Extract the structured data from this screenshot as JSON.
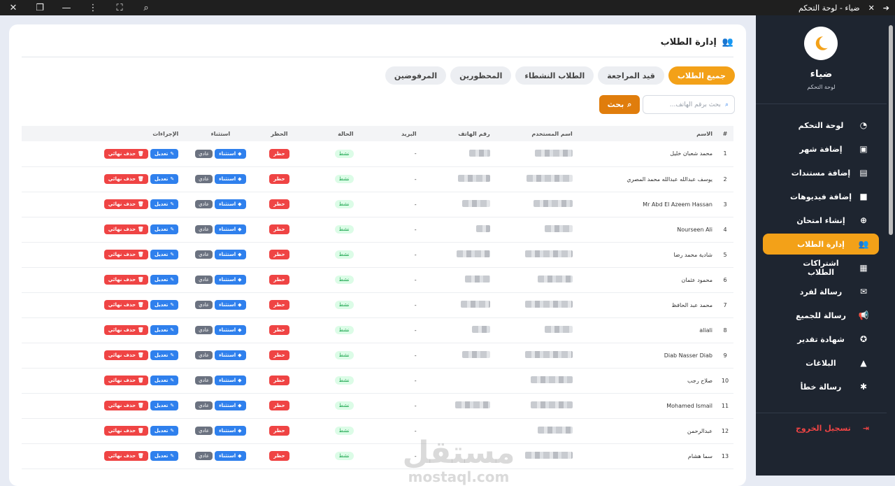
{
  "window": {
    "title": "ضياء - لوحة التحكم"
  },
  "sidebar": {
    "brand": "ضياء",
    "brand_sub": "لوحة التحكم",
    "items": [
      {
        "label": "لوحة التحكم",
        "icon": "dashboard-icon",
        "active": false
      },
      {
        "label": "إضافة شهر",
        "icon": "calendar-plus-icon",
        "active": false
      },
      {
        "label": "إضافة مستندات",
        "icon": "file-icon",
        "active": false
      },
      {
        "label": "إضافة فيديوهات",
        "icon": "video-icon",
        "active": false
      },
      {
        "label": "إنشاء امتحان",
        "icon": "plus-circle-icon",
        "active": false
      },
      {
        "label": "إدارة الطلاب",
        "icon": "users-icon",
        "active": true
      },
      {
        "label": "اشتراكات الطلاب",
        "icon": "calendar-check-icon",
        "active": false
      },
      {
        "label": "رسالة لفرد",
        "icon": "envelope-icon",
        "active": false
      },
      {
        "label": "رسالة للجميع",
        "icon": "megaphone-icon",
        "active": false
      },
      {
        "label": "شهادة تقدير",
        "icon": "award-icon",
        "active": false
      },
      {
        "label": "البلاغات",
        "icon": "warning-icon",
        "active": false
      },
      {
        "label": "رسالة خطأ",
        "icon": "bug-icon",
        "active": false
      }
    ],
    "logout": "تسجيل الخروج"
  },
  "main": {
    "title": "إدارة الطلاب",
    "tabs": [
      {
        "label": "جميع الطلاب",
        "active": true
      },
      {
        "label": "قيد المراجعة",
        "active": false
      },
      {
        "label": "الطلاب النشطاء",
        "active": false
      },
      {
        "label": "المحظورين",
        "active": false
      },
      {
        "label": "المرفوضين",
        "active": false
      }
    ],
    "search_placeholder": "بحث برقم الهاتف...",
    "search_button": "بحث",
    "columns": {
      "num": "#",
      "name": "الاسم",
      "user": "اسم المستخدم",
      "phone": "رقم الهاتف",
      "mail": "البريد",
      "state": "الحالة",
      "ban": "الحظر",
      "exception": "استثناء",
      "actions": "الإجراءات"
    },
    "labels": {
      "status": "نشط",
      "ban": "حظر",
      "normal": "عادي",
      "exception": "استثناء",
      "edit": "تعديل",
      "delete": "حذف نهائي",
      "mail_empty": "-"
    },
    "rows": [
      {
        "num": "1",
        "name": "محمد شعبان خليل"
      },
      {
        "num": "2",
        "name": "يوسف عبدالله عبدالله محمد المصري"
      },
      {
        "num": "3",
        "name": "Mr Abd El Azeem Hassan"
      },
      {
        "num": "4",
        "name": "Nourseen Ali"
      },
      {
        "num": "5",
        "name": "شادية محمد رضا"
      },
      {
        "num": "6",
        "name": "محمود عثمان"
      },
      {
        "num": "7",
        "name": "محمد عبد الحافظ"
      },
      {
        "num": "8",
        "name": "aliali"
      },
      {
        "num": "9",
        "name": "Diab Nasser Diab"
      },
      {
        "num": "10",
        "name": "صلاح رجب"
      },
      {
        "num": "11",
        "name": "Mohamed Ismail"
      },
      {
        "num": "12",
        "name": "عبدالرحمن"
      },
      {
        "num": "13",
        "name": "سما هشام"
      }
    ]
  },
  "watermark": {
    "ar": "مستقل",
    "en": "mostaql.com"
  }
}
